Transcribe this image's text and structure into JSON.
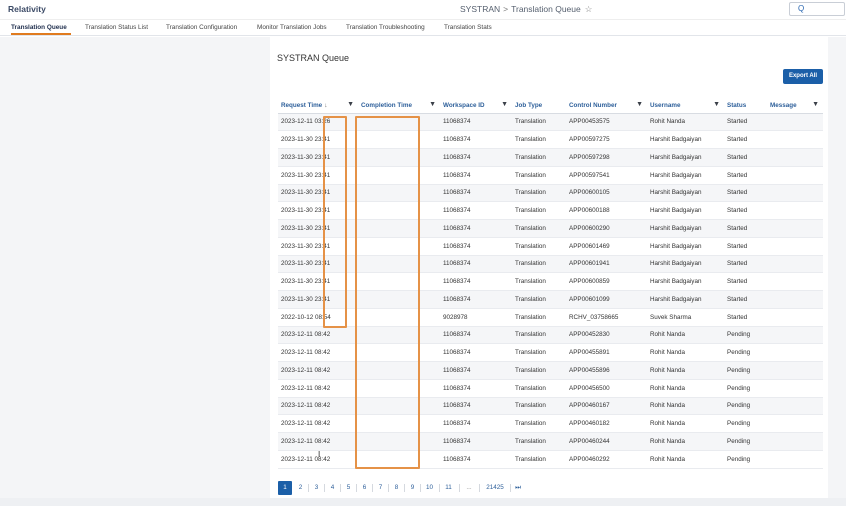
{
  "app": {
    "brand": "Relativity"
  },
  "breadcrumb": {
    "parent": "SYSTRAN",
    "separator": ">",
    "current": "Translation Queue",
    "star": "☆"
  },
  "search": {
    "icon": "search-icon",
    "glyph": "Q"
  },
  "tabs": [
    {
      "label": "Translation Queue",
      "active": true
    },
    {
      "label": "Translation Status List",
      "active": false
    },
    {
      "label": "Translation Configuration",
      "active": false
    },
    {
      "label": "Monitor Translation Jobs",
      "active": false
    },
    {
      "label": "Translation Troubleshooting",
      "active": false
    },
    {
      "label": "Translation Stats",
      "active": false
    }
  ],
  "page": {
    "title": "SYSTRAN Queue",
    "export_label": "Export All"
  },
  "table": {
    "sort_indicator": "↓",
    "filter_glyph": "▼",
    "columns": [
      {
        "label": "Request Time",
        "filter": true,
        "sorted": true
      },
      {
        "label": "Completion Time",
        "filter": true
      },
      {
        "label": "Workspace ID",
        "filter": true
      },
      {
        "label": "Job Type",
        "filter": false
      },
      {
        "label": "Control Number",
        "filter": true
      },
      {
        "label": "Username",
        "filter": true
      },
      {
        "label": "Status",
        "filter": false
      },
      {
        "label": "Message",
        "filter": true
      }
    ],
    "rows": [
      [
        "2023-12-11 03:26",
        "",
        "11068374",
        "Translation",
        "APP00453575",
        "Rohit Nanda",
        "Started",
        ""
      ],
      [
        "2023-11-30 23:41",
        "",
        "11068374",
        "Translation",
        "APP00597275",
        "Harshit Badgaiyan",
        "Started",
        ""
      ],
      [
        "2023-11-30 23:41",
        "",
        "11068374",
        "Translation",
        "APP00597298",
        "Harshit Badgaiyan",
        "Started",
        ""
      ],
      [
        "2023-11-30 23:41",
        "",
        "11068374",
        "Translation",
        "APP00597541",
        "Harshit Badgaiyan",
        "Started",
        ""
      ],
      [
        "2023-11-30 23:41",
        "",
        "11068374",
        "Translation",
        "APP00600105",
        "Harshit Badgaiyan",
        "Started",
        ""
      ],
      [
        "2023-11-30 23:41",
        "",
        "11068374",
        "Translation",
        "APP00600188",
        "Harshit Badgaiyan",
        "Started",
        ""
      ],
      [
        "2023-11-30 23:41",
        "",
        "11068374",
        "Translation",
        "APP00600290",
        "Harshit Badgaiyan",
        "Started",
        ""
      ],
      [
        "2023-11-30 23:41",
        "",
        "11068374",
        "Translation",
        "APP00601469",
        "Harshit Badgaiyan",
        "Started",
        ""
      ],
      [
        "2023-11-30 23:41",
        "",
        "11068374",
        "Translation",
        "APP00601941",
        "Harshit Badgaiyan",
        "Started",
        ""
      ],
      [
        "2023-11-30 23:41",
        "",
        "11068374",
        "Translation",
        "APP00600859",
        "Harshit Badgaiyan",
        "Started",
        ""
      ],
      [
        "2023-11-30 23:41",
        "",
        "11068374",
        "Translation",
        "APP00601099",
        "Harshit Badgaiyan",
        "Started",
        ""
      ],
      [
        "2022-10-12 08:54",
        "",
        "9028978",
        "Translation",
        "RCHV_03758665",
        "Suvek Sharma",
        "Started",
        ""
      ],
      [
        "2023-12-11 08:42",
        "",
        "11068374",
        "Translation",
        "APP00452830",
        "Rohit Nanda",
        "Pending",
        ""
      ],
      [
        "2023-12-11 08:42",
        "",
        "11068374",
        "Translation",
        "APP00455891",
        "Rohit Nanda",
        "Pending",
        ""
      ],
      [
        "2023-12-11 08:42",
        "",
        "11068374",
        "Translation",
        "APP00455896",
        "Rohit Nanda",
        "Pending",
        ""
      ],
      [
        "2023-12-11 08:42",
        "",
        "11068374",
        "Translation",
        "APP00456500",
        "Rohit Nanda",
        "Pending",
        ""
      ],
      [
        "2023-12-11 08:42",
        "",
        "11068374",
        "Translation",
        "APP00460167",
        "Rohit Nanda",
        "Pending",
        ""
      ],
      [
        "2023-12-11 08:42",
        "",
        "11068374",
        "Translation",
        "APP00460182",
        "Rohit Nanda",
        "Pending",
        ""
      ],
      [
        "2023-12-11 08:42",
        "",
        "11068374",
        "Translation",
        "APP00460244",
        "Rohit Nanda",
        "Pending",
        ""
      ],
      [
        "2023-12-11 08:42",
        "",
        "11068374",
        "Translation",
        "APP00460292",
        "Rohit Nanda",
        "Pending",
        ""
      ]
    ]
  },
  "pagination": {
    "pages": [
      "1",
      "2",
      "3",
      "4",
      "5",
      "6",
      "7",
      "8",
      "9",
      "10",
      "11",
      "...",
      "21425"
    ],
    "current": "1",
    "last_glyph": "⏭"
  },
  "colors": {
    "accent": "#1b5fa8",
    "tab_underline": "#e07b1f",
    "highlight_box": "#e59247"
  }
}
